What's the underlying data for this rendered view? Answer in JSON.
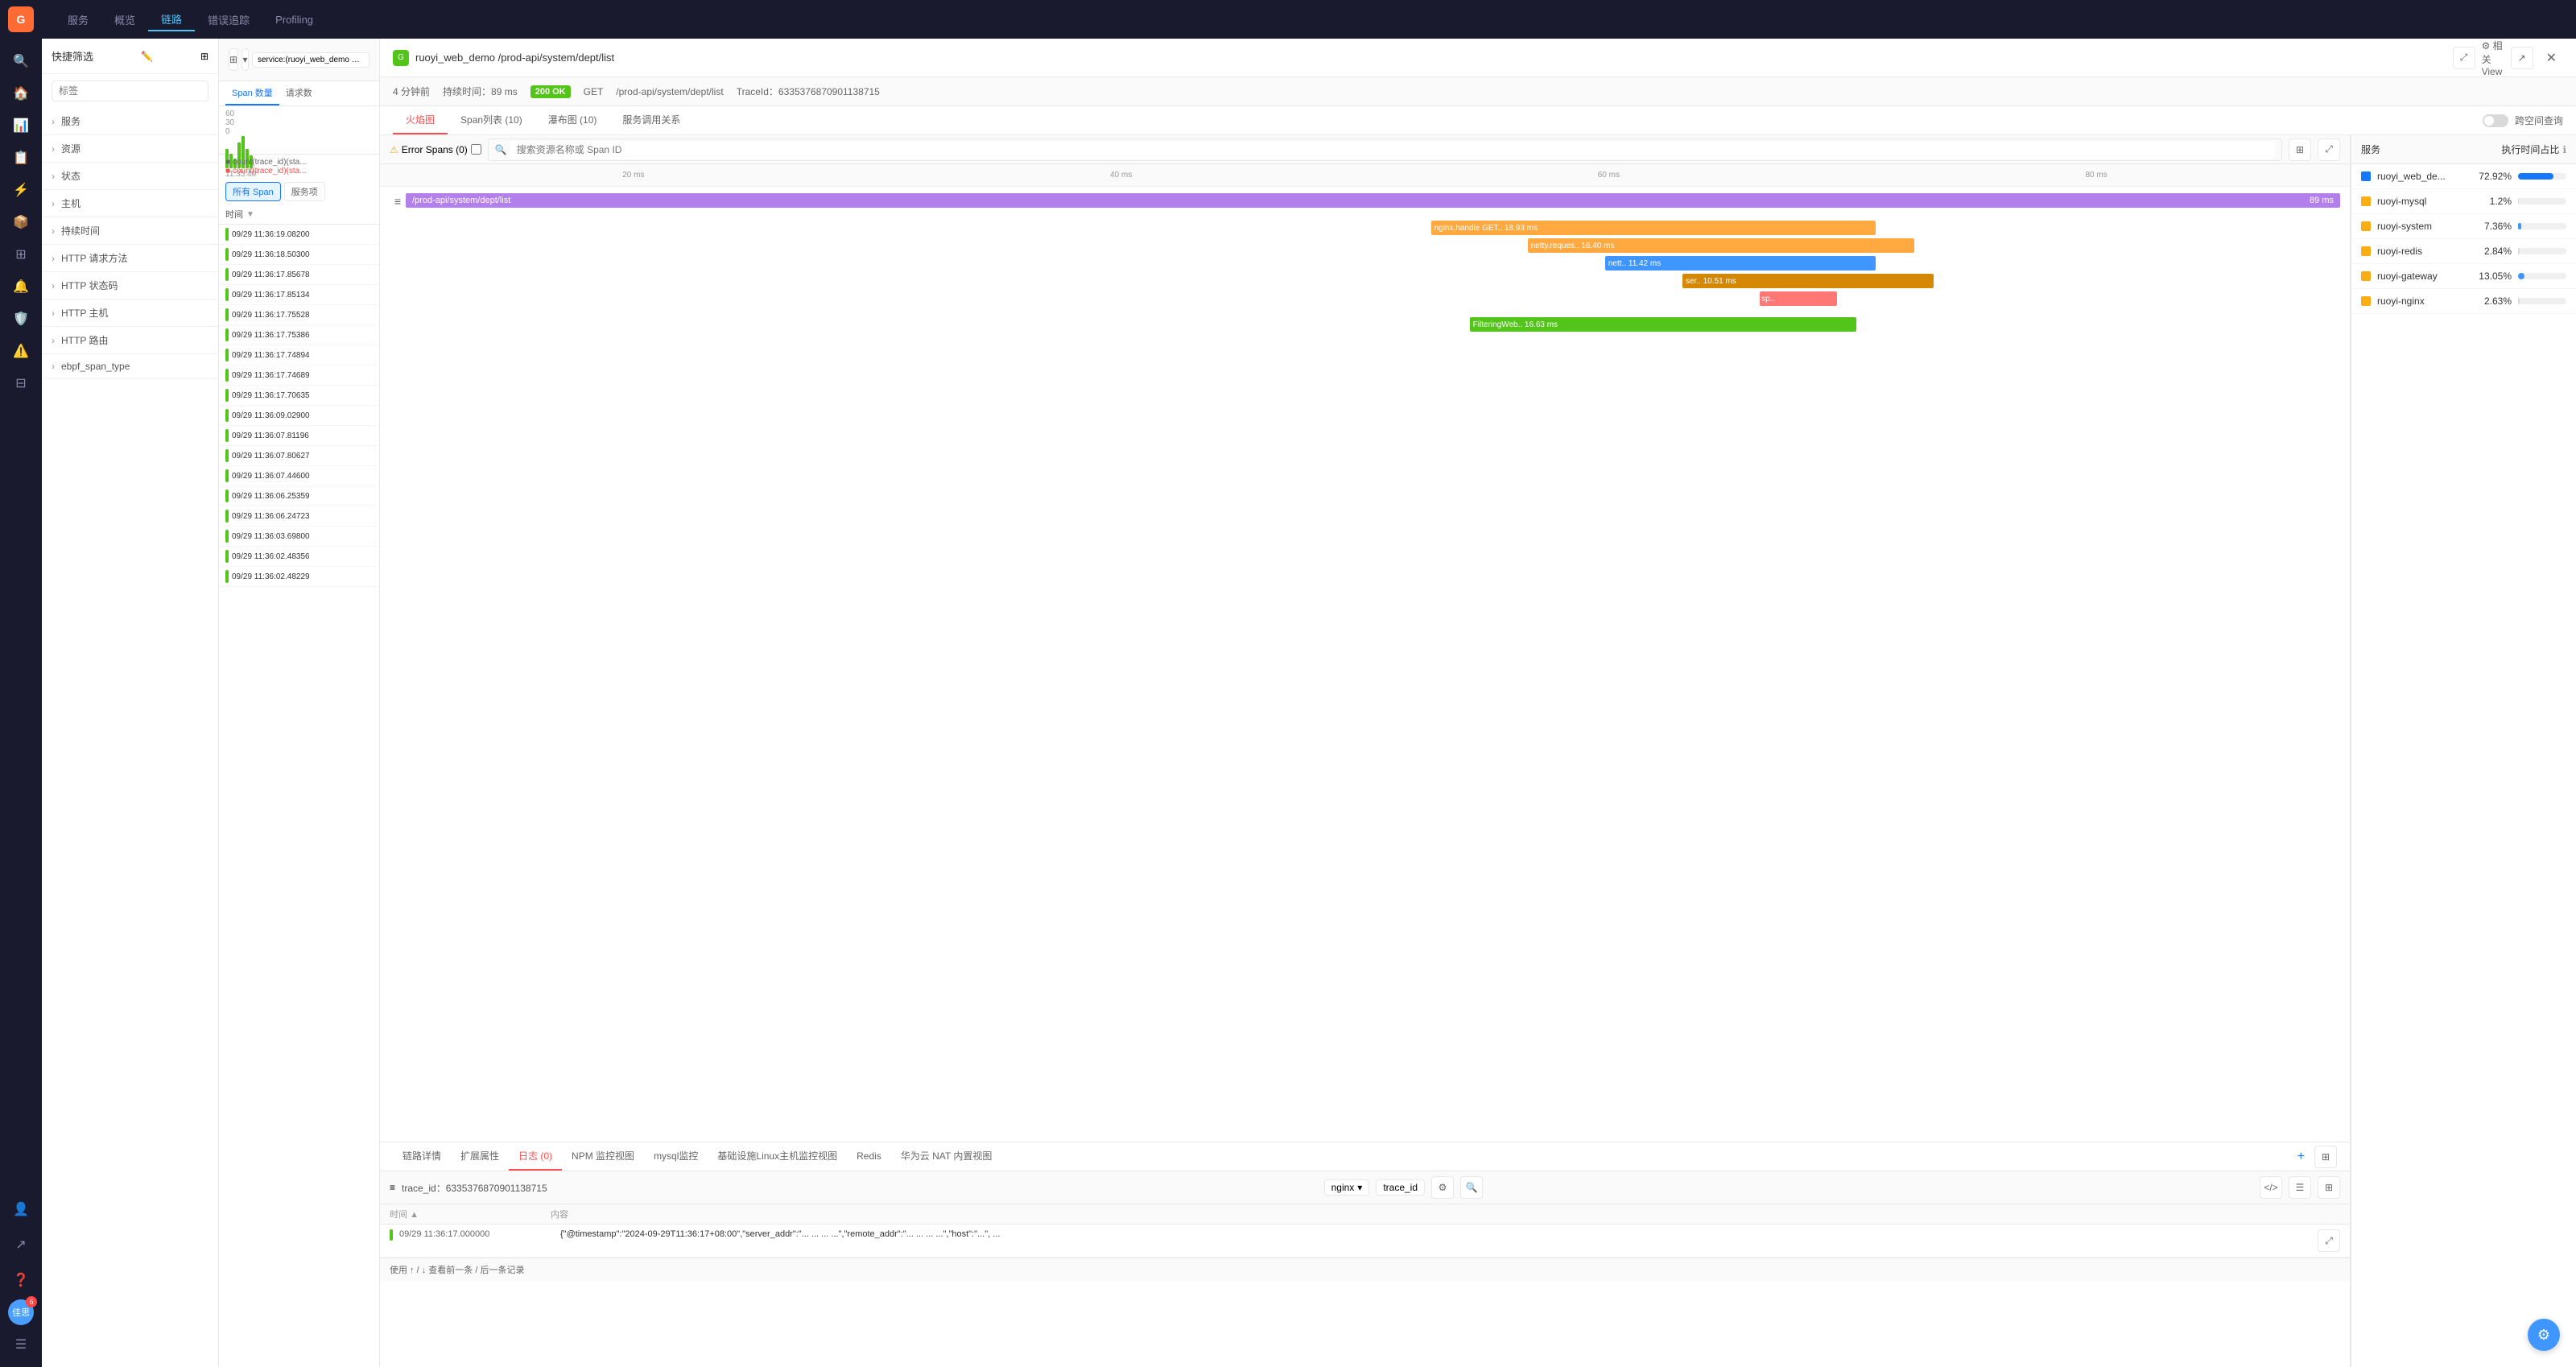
{
  "appLogo": "G",
  "nav": {
    "items": [
      {
        "label": "服务",
        "active": false
      },
      {
        "label": "概览",
        "active": false
      },
      {
        "label": "链路",
        "active": true
      },
      {
        "label": "错误追踪",
        "active": false
      },
      {
        "label": "Profiling",
        "active": false
      }
    ]
  },
  "sidebar_icons": [
    "🔍",
    "🏠",
    "📊",
    "📋",
    "⚡",
    "📦",
    "📁",
    "🔔",
    "⚙️",
    "🛡️",
    "⚠️"
  ],
  "filter": {
    "title": "快捷筛选",
    "search_placeholder": "标签",
    "groups": [
      {
        "label": "服务"
      },
      {
        "label": "资源"
      },
      {
        "label": "状态"
      },
      {
        "label": "主机"
      },
      {
        "label": "持续时间"
      },
      {
        "label": "HTTP 请求方法"
      },
      {
        "label": "HTTP 状态码"
      },
      {
        "label": "HTTP 主机"
      },
      {
        "label": "HTTP 路由"
      },
      {
        "label": "ebpf_span_type"
      }
    ]
  },
  "search_bar": {
    "value": "service:(ruoyi_web_demo OR ruoyi-system)",
    "icons": [
      "grid",
      "chevron-down",
      "search"
    ]
  },
  "trace_list": {
    "tabs": [
      {
        "label": "Span 数量",
        "active": true
      },
      {
        "label": "请求数",
        "active": false
      }
    ],
    "span_filters": [
      {
        "label": "所有 Span",
        "active": true
      },
      {
        "label": "服务项",
        "active": false
      }
    ],
    "sort_label": "时间",
    "items": [
      {
        "time": "09/29 11:36:19.08200",
        "color": "green"
      },
      {
        "time": "09/29 11:36:18.50300",
        "color": "green"
      },
      {
        "time": "09/29 11:36:17.85678",
        "color": "green"
      },
      {
        "time": "09/29 11:36:17.85134",
        "color": "green"
      },
      {
        "time": "09/29 11:36:17.75528",
        "color": "green"
      },
      {
        "time": "09/29 11:36:17.75386",
        "color": "green"
      },
      {
        "time": "09/29 11:36:17.74894",
        "color": "green"
      },
      {
        "time": "09/29 11:36:17.74689",
        "color": "green"
      },
      {
        "time": "09/29 11:36:17.70635",
        "color": "green"
      },
      {
        "time": "09/29 11:36:09.02900",
        "color": "green"
      },
      {
        "time": "09/29 11:36:07.81196",
        "color": "green"
      },
      {
        "time": "09/29 11:36:07.80627",
        "color": "green"
      },
      {
        "time": "09/29 11:36:07.44600",
        "color": "green"
      },
      {
        "time": "09/29 11:36:06.25359",
        "color": "green"
      },
      {
        "time": "09/29 11:36:06.24723",
        "color": "green"
      },
      {
        "time": "09/29 11:36:03.69800",
        "color": "green"
      },
      {
        "time": "09/29 11:36:02.48356",
        "color": "green"
      },
      {
        "time": "09/29 11:36:02.48229",
        "color": "green"
      }
    ]
  },
  "modal": {
    "service_name": "ruoyi_web_demo",
    "url": "/prod-api/system/dept/list",
    "time_ago": "4 分钟前",
    "duration": "持续时间：89 ms",
    "status": "200 OK",
    "method": "GET",
    "path": "/prod-api/system/dept/list",
    "trace_id_label": "TraceId：6335376870901138715",
    "tabs": [
      {
        "label": "火焰图",
        "active": true
      },
      {
        "label": "Span列表 (10)",
        "active": false
      },
      {
        "label": "瀑布图 (10)",
        "active": false
      },
      {
        "label": "服务调用关系",
        "active": false
      }
    ],
    "toggle_label": "跨空间查询",
    "flamegraph": {
      "error_filter": "Error Spans (0)",
      "search_placeholder": "搜索资源名称或 Span ID",
      "timeline": [
        "20 ms",
        "40 ms",
        "60 ms",
        "80 ms"
      ],
      "spans": [
        {
          "label": "/prod-api/system/dept/list",
          "duration": "89 ms",
          "color": "purple",
          "left_pct": 0,
          "width_pct": 100
        },
        {
          "label": "nginx.handle GET.. 18.93 ms",
          "color": "orange",
          "left_pct": 53,
          "width_pct": 23
        },
        {
          "label": "netty.reques.. 16.40 ms",
          "color": "orange",
          "left_pct": 58,
          "width_pct": 20
        },
        {
          "label": "nett.. 11.42 ms",
          "color": "blue",
          "left_pct": 62,
          "width_pct": 14
        },
        {
          "label": "ser.. 10.51 ms",
          "color": "brown",
          "left_pct": 66,
          "width_pct": 13
        },
        {
          "label": "sp..",
          "color": "red",
          "left_pct": 70,
          "width_pct": 4
        },
        {
          "label": "FilteringWeb.. 16.63 ms",
          "color": "green",
          "left_pct": 55,
          "width_pct": 20
        }
      ]
    },
    "services": {
      "header": "服务",
      "time_header": "执行时间占比",
      "items": [
        {
          "name": "ruoyi_web_de...",
          "pct": "72.92%",
          "color": "#1677ff",
          "bar_pct": 73
        },
        {
          "name": "ruoyi-mysql",
          "pct": "1.2%",
          "color": "#d9d9d9",
          "bar_pct": 1
        },
        {
          "name": "ruoyi-system",
          "pct": "7.36%",
          "color": "#4096ff",
          "bar_pct": 7
        },
        {
          "name": "ruoyi-redis",
          "pct": "2.84%",
          "color": "#d9d9d9",
          "bar_pct": 3
        },
        {
          "name": "ruoyi-gateway",
          "pct": "13.05%",
          "color": "#4096ff",
          "bar_pct": 13
        },
        {
          "name": "ruoyi-nginx",
          "pct": "2.63%",
          "color": "#d9d9d9",
          "bar_pct": 3
        }
      ]
    },
    "bottom_tabs": [
      {
        "label": "链路详情"
      },
      {
        "label": "扩展属性"
      },
      {
        "label": "日志 (0)",
        "active": true
      },
      {
        "label": "NPM 监控视图"
      },
      {
        "label": "mysql监控"
      },
      {
        "label": "基础设施Linux主机监控视图"
      },
      {
        "label": "Redis"
      },
      {
        "label": "华为云 NAT 内置视图"
      }
    ],
    "log": {
      "trace_id": "trace_id：6335376870901138715",
      "filter_options": [
        "nginx"
      ],
      "filter_value": "nginx",
      "field_value": "trace_id",
      "columns": [
        "时间",
        "内容"
      ],
      "rows": [
        {
          "time": "09/29 11:36:17.000000",
          "content": "{\"@timestamp\":\"2024-09-29T11:36:17+08:00\",\"server_addr\":\"... ... ... ...\",\"remote_addr\":\"... ... ... ...\",\"host\":\"...\", ...",
          "indicator": "green"
        }
      ],
      "footer": "使用 ↑ / ↓ 查看前一条 / 后一条记录"
    }
  }
}
